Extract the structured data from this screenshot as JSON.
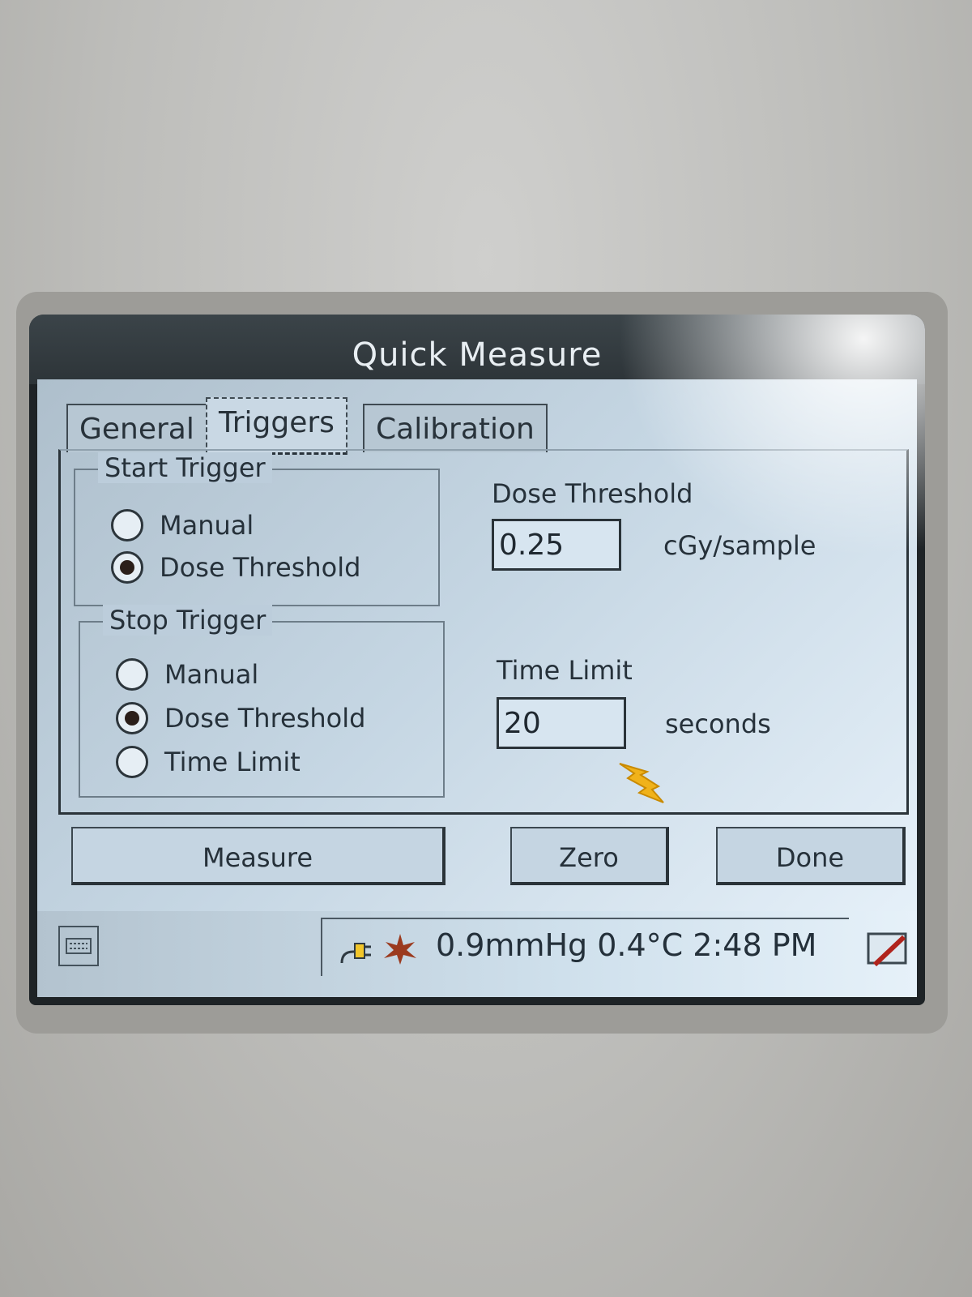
{
  "window": {
    "title": "Quick Measure"
  },
  "tabs": [
    {
      "label": "General"
    },
    {
      "label": "Triggers"
    },
    {
      "label": "Calibration"
    }
  ],
  "start_trigger": {
    "title": "Start Trigger",
    "options": [
      {
        "label": "Manual",
        "selected": false
      },
      {
        "label": "Dose Threshold",
        "selected": true
      }
    ]
  },
  "stop_trigger": {
    "title": "Stop Trigger",
    "options": [
      {
        "label": "Manual",
        "selected": false
      },
      {
        "label": "Dose Threshold",
        "selected": true
      },
      {
        "label": "Time Limit",
        "selected": false
      }
    ]
  },
  "dose_threshold": {
    "label": "Dose Threshold",
    "value": "0.25",
    "unit": "cGy/sample"
  },
  "time_limit": {
    "label": "Time Limit",
    "value": "20",
    "unit": "seconds"
  },
  "buttons": {
    "measure": "Measure",
    "zero": "Zero",
    "done": "Done"
  },
  "status": {
    "readout": "0.9mmHg  0.4°C  2:48 PM"
  },
  "icons": {
    "keyboard": "keyboard-icon",
    "power": "power-plug-icon",
    "network": "network-icon",
    "pen": "pen-input-icon"
  }
}
